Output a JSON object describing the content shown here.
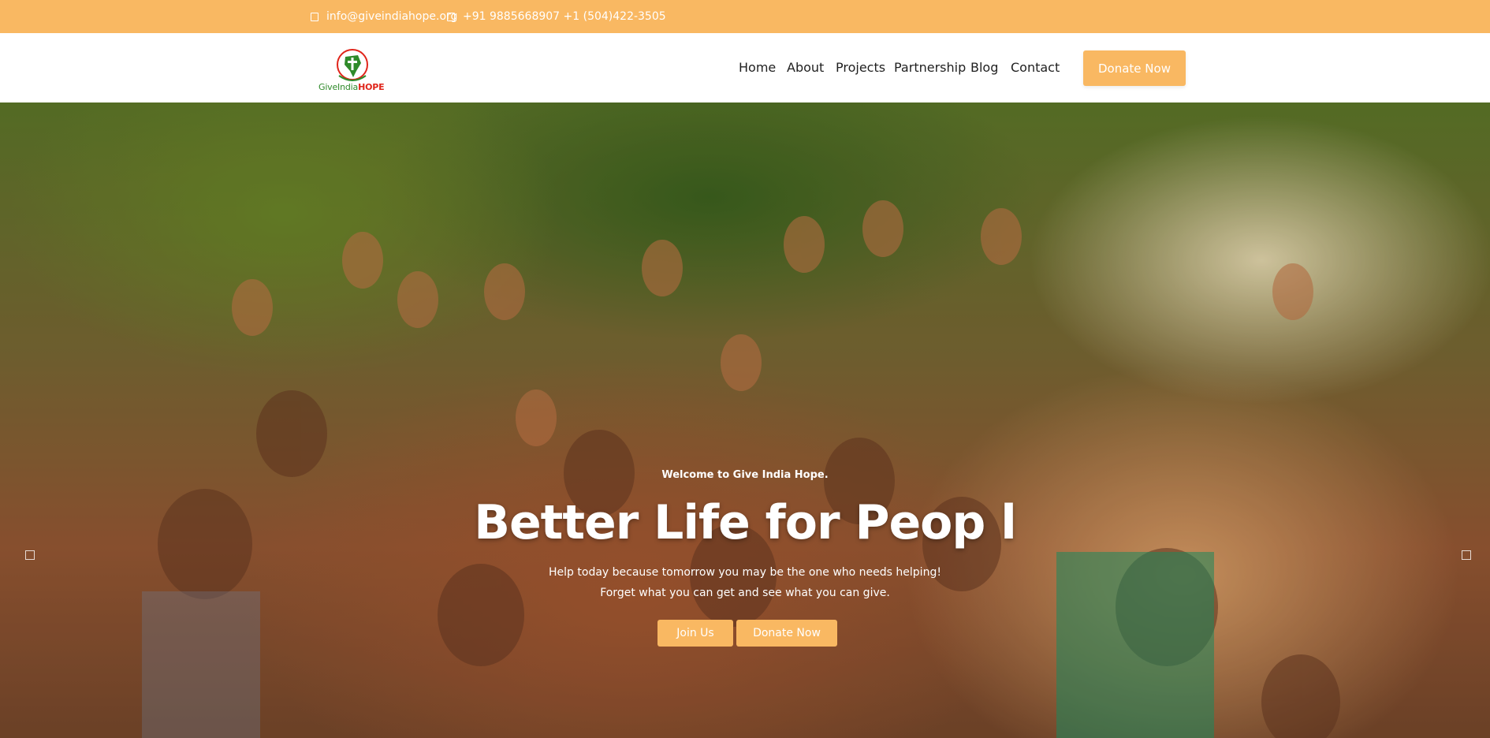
{
  "topbar": {
    "email": "info@giveindiahope.org",
    "phone": "+91 9885668907 +1 (504)422-3505"
  },
  "logo": {
    "wordmark_part1": "GiveIndia",
    "wordmark_part2": "HOPE"
  },
  "nav": {
    "items": [
      {
        "label": "Home"
      },
      {
        "label": "About"
      },
      {
        "label": "Projects"
      },
      {
        "label": "Partnership"
      },
      {
        "label": "Blog"
      },
      {
        "label": "Contact"
      }
    ],
    "donate_label": "Donate Now"
  },
  "hero": {
    "welcome": "Welcome to Give India Hope.",
    "headline": "Better Life for Peop l",
    "subtitle_line1": "Help today because tomorrow you may be the one who needs helping!",
    "subtitle_line2": "Forget what you can get and see what you can give.",
    "button_a": "Join Us",
    "button_b": "Donate Now"
  },
  "colors": {
    "accent": "#f9b862",
    "logo_green": "#2f8a2a",
    "logo_red": "#e0251b"
  }
}
